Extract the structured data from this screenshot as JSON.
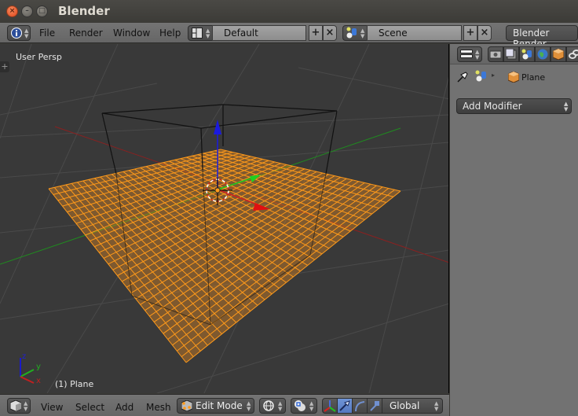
{
  "window": {
    "title": "Blender",
    "buttons": {
      "close": "×",
      "minimize": "–",
      "maximize": "□"
    }
  },
  "topbar": {
    "editor_type_icon": "info-icon",
    "menus": [
      "File",
      "Render",
      "Window",
      "Help"
    ],
    "screen_layout": {
      "icon": "layout-icon",
      "value": "Default"
    },
    "scene": {
      "icon": "scene-icon",
      "value": "Scene"
    },
    "add_symbol": "+",
    "remove_symbol": "×",
    "render_engine": "Blender Render"
  },
  "viewport": {
    "view_label": "User Persp",
    "object_label": "(1) Plane",
    "axes": {
      "x": "x",
      "y": "y",
      "z": "z"
    },
    "colors": {
      "x_axis": "#c02020",
      "y_axis": "#20b020",
      "z_axis": "#2020d0",
      "selection": "#ff9a1a",
      "background": "#393939"
    }
  },
  "properties": {
    "editor_type_icon": "properties-icon",
    "tabs": [
      "render-icon",
      "render-layers-icon",
      "scene-icon",
      "world-icon",
      "object-icon",
      "constraints-icon"
    ],
    "breadcrumb": {
      "object_name": "Plane"
    },
    "add_modifier_label": "Add Modifier"
  },
  "bottombar": {
    "editor_type_icon": "3d-view-icon",
    "menus": [
      "View",
      "Select",
      "Add",
      "Mesh"
    ],
    "mode": {
      "icon": "edit-mode-icon",
      "value": "Edit Mode"
    },
    "shading_icon": "viewport-shading-icon",
    "pivot_icon": "pivot-point-icon",
    "manipulator_icons": [
      "manipulator-toggle-icon",
      "translate-icon",
      "rotate-icon",
      "scale-icon"
    ],
    "orientation": "Global"
  }
}
